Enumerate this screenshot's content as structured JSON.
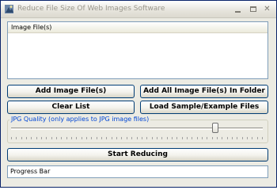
{
  "window": {
    "title": "Reduce File Size Of Web Images Software"
  },
  "file_list": {
    "header": "Image File(s)",
    "rows": []
  },
  "buttons": {
    "add": "Add Image File(s)",
    "add_all": "Add All Image File(s) In Folder",
    "clear": "Clear List",
    "load_sample": "Load Sample/Example Files",
    "start": "Start Reducing"
  },
  "quality": {
    "label": "JPG Quality (only applies to JPG image files)",
    "level_fraction": 0.82
  },
  "progress": {
    "text": "Progress Bar"
  },
  "icons": {
    "app": "app-icon",
    "minimize": "minimize-icon",
    "maximize": "maximize-icon",
    "close": "close-icon"
  }
}
